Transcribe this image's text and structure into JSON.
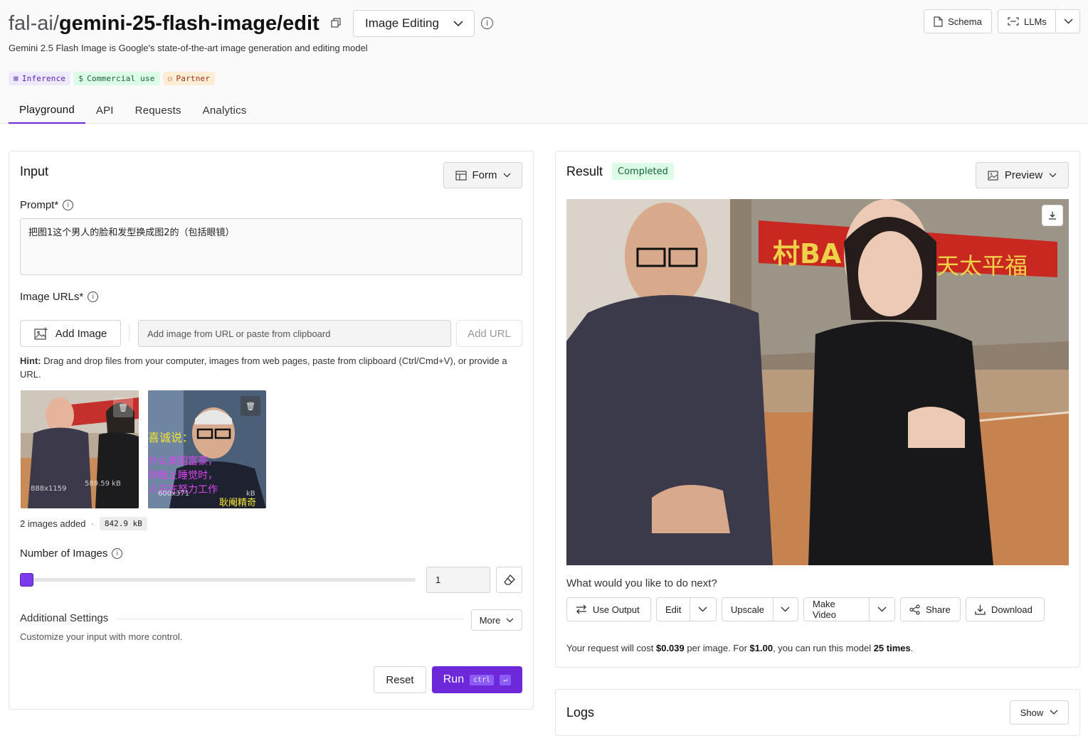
{
  "header": {
    "title_prefix": "fal-ai/",
    "title_main": "gemini-25-flash-image/edit",
    "category": "Image Editing",
    "subtitle": "Gemini 2.5 Flash Image is Google's state-of-the-art image generation and editing model",
    "badges": [
      "Inference",
      "Commercial use",
      "Partner"
    ],
    "schema_label": "Schema",
    "llms_label": "LLMs"
  },
  "tabs": [
    "Playground",
    "API",
    "Requests",
    "Analytics"
  ],
  "input": {
    "title": "Input",
    "mode": "Form",
    "prompt_label": "Prompt",
    "prompt_value": "把图1这个男人的脸和发型换成图2的（包括眼镜）",
    "image_urls_label": "Image URLs",
    "add_image": "Add Image",
    "url_placeholder": "Add image from URL or paste from clipboard",
    "add_url": "Add URL",
    "hint_bold": "Hint:",
    "hint_text": " Drag and drop files from your computer, images from web pages, paste from clipboard (Ctrl/Cmd+V), or provide a URL.",
    "images": [
      {
        "dims": "888x1159",
        "size": "589.59 kB"
      },
      {
        "dims": "600x371",
        "size": "kB"
      }
    ],
    "images_added": "2 images added",
    "total_size": "842.9 kB",
    "num_images_label": "Number of Images",
    "num_images_value": "1",
    "num_images_slider_fraction": 0,
    "additional_settings": "Additional Settings",
    "additional_desc": "Customize your input with more control.",
    "more": "More",
    "reset": "Reset",
    "run": "Run",
    "kbd_ctrl": "ctrl",
    "kbd_enter": "↵"
  },
  "result": {
    "title": "Result",
    "status": "Completed",
    "view": "Preview",
    "next_prompt": "What would you like to do next?",
    "actions": [
      "Use Output",
      "Edit",
      "Upscale",
      "Make Video",
      "Share",
      "Download"
    ],
    "cost_pre": "Your request will cost ",
    "cost_price": "$0.039",
    "cost_mid": " per image. For ",
    "cost_budget": "$1.00",
    "cost_mid2": ", you can run this model ",
    "cost_times": "25 times",
    "cost_end": "."
  },
  "logs": {
    "title": "Logs",
    "show": "Show"
  },
  "colors": {
    "accent": "#6d28d9",
    "status_bg": "#dcfce7",
    "status_fg": "#166534"
  }
}
